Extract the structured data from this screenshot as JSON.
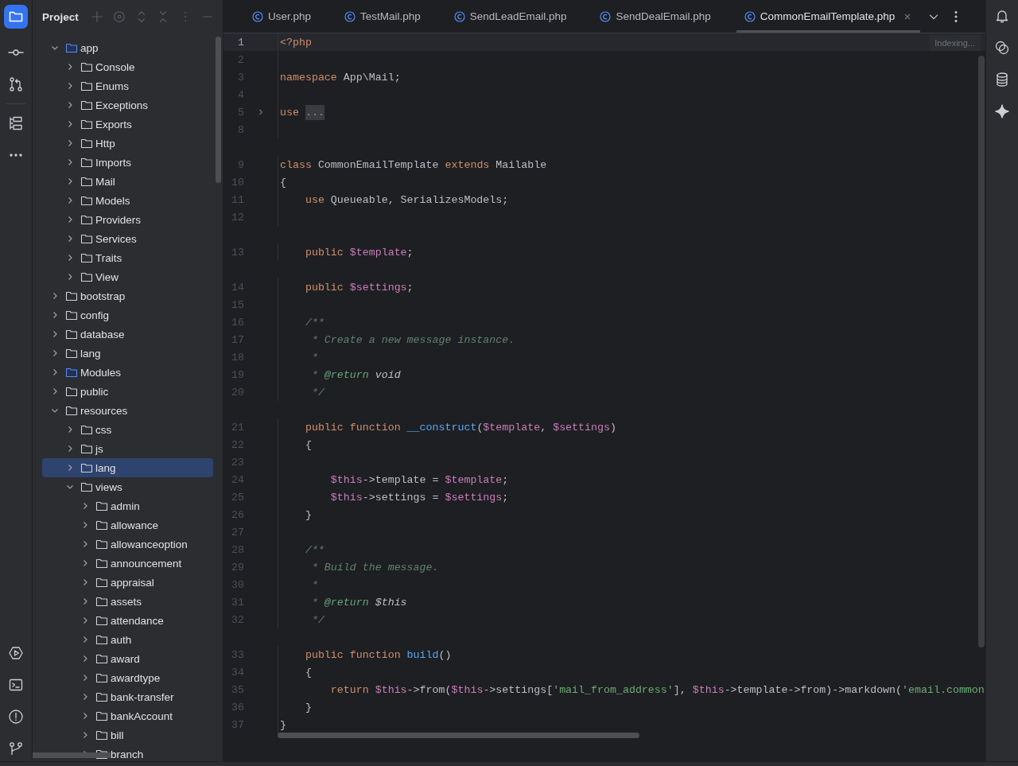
{
  "project_panel": {
    "title": "Project",
    "tree": [
      {
        "label": "app",
        "kind": "source",
        "expanded": true,
        "selected": false,
        "children": [
          {
            "label": "Console",
            "kind": "folder",
            "expanded": false,
            "selected": false
          },
          {
            "label": "Enums",
            "kind": "folder",
            "expanded": false,
            "selected": false
          },
          {
            "label": "Exceptions",
            "kind": "folder",
            "expanded": false,
            "selected": false
          },
          {
            "label": "Exports",
            "kind": "folder",
            "expanded": false,
            "selected": false
          },
          {
            "label": "Http",
            "kind": "folder",
            "expanded": false,
            "selected": false
          },
          {
            "label": "Imports",
            "kind": "folder",
            "expanded": false,
            "selected": false
          },
          {
            "label": "Mail",
            "kind": "folder",
            "expanded": false,
            "selected": false
          },
          {
            "label": "Models",
            "kind": "folder",
            "expanded": false,
            "selected": false
          },
          {
            "label": "Providers",
            "kind": "folder",
            "expanded": false,
            "selected": false
          },
          {
            "label": "Services",
            "kind": "folder",
            "expanded": false,
            "selected": false
          },
          {
            "label": "Traits",
            "kind": "folder",
            "expanded": false,
            "selected": false
          },
          {
            "label": "View",
            "kind": "folder",
            "expanded": false,
            "selected": false
          }
        ]
      },
      {
        "label": "bootstrap",
        "kind": "folder",
        "expanded": false,
        "selected": false
      },
      {
        "label": "config",
        "kind": "folder",
        "expanded": false,
        "selected": false
      },
      {
        "label": "database",
        "kind": "folder",
        "expanded": false,
        "selected": false
      },
      {
        "label": "lang",
        "kind": "folder",
        "expanded": false,
        "selected": false
      },
      {
        "label": "Modules",
        "kind": "source",
        "expanded": false,
        "selected": false
      },
      {
        "label": "public",
        "kind": "folder",
        "expanded": false,
        "selected": false
      },
      {
        "label": "resources",
        "kind": "folder",
        "expanded": true,
        "selected": false,
        "children": [
          {
            "label": "css",
            "kind": "folder",
            "expanded": false,
            "selected": false
          },
          {
            "label": "js",
            "kind": "folder",
            "expanded": false,
            "selected": false
          },
          {
            "label": "lang",
            "kind": "folder",
            "expanded": false,
            "selected": true
          },
          {
            "label": "views",
            "kind": "folder",
            "expanded": true,
            "selected": false,
            "children": [
              {
                "label": "admin",
                "kind": "folder",
                "expanded": false,
                "selected": false
              },
              {
                "label": "allowance",
                "kind": "folder",
                "expanded": false,
                "selected": false
              },
              {
                "label": "allowanceoption",
                "kind": "folder",
                "expanded": false,
                "selected": false
              },
              {
                "label": "announcement",
                "kind": "folder",
                "expanded": false,
                "selected": false
              },
              {
                "label": "appraisal",
                "kind": "folder",
                "expanded": false,
                "selected": false
              },
              {
                "label": "assets",
                "kind": "folder",
                "expanded": false,
                "selected": false
              },
              {
                "label": "attendance",
                "kind": "folder",
                "expanded": false,
                "selected": false
              },
              {
                "label": "auth",
                "kind": "folder",
                "expanded": false,
                "selected": false
              },
              {
                "label": "award",
                "kind": "folder",
                "expanded": false,
                "selected": false
              },
              {
                "label": "awardtype",
                "kind": "folder",
                "expanded": false,
                "selected": false
              },
              {
                "label": "bank-transfer",
                "kind": "folder",
                "expanded": false,
                "selected": false
              },
              {
                "label": "bankAccount",
                "kind": "folder",
                "expanded": false,
                "selected": false
              },
              {
                "label": "bill",
                "kind": "folder",
                "expanded": false,
                "selected": false
              },
              {
                "label": "branch",
                "kind": "folder",
                "expanded": false,
                "selected": false
              }
            ]
          }
        ]
      }
    ]
  },
  "tabs": [
    {
      "label": "User.php",
      "selected": false
    },
    {
      "label": "TestMail.php",
      "selected": false
    },
    {
      "label": "SendLeadEmail.php",
      "selected": false
    },
    {
      "label": "SendDealEmail.php",
      "selected": false
    },
    {
      "label": "CommonEmailTemplate.php",
      "selected": true
    }
  ],
  "editor": {
    "status": "Indexing...",
    "code": [
      [
        {
          "n": "1",
          "current": true,
          "tokens": [
            {
              "kind": "kw",
              "text": "<?php"
            }
          ]
        },
        {
          "n": "2",
          "current": false
        },
        {
          "n": "3",
          "current": false,
          "tokens": [
            {
              "kind": "kw",
              "text": "namespace"
            },
            {
              "kind": "pl",
              "text": " App\\Mail;"
            }
          ]
        },
        {
          "n": "4",
          "current": false
        },
        {
          "n": "5",
          "current": false,
          "tokens": [
            {
              "kind": "kw",
              "text": "use "
            },
            {
              "kind": "fold",
              "text": "..."
            }
          ]
        },
        {
          "n": "8",
          "current": false
        }
      ],
      [
        {
          "n": "9",
          "current": false,
          "tokens": [
            {
              "kind": "kw",
              "text": "class"
            },
            {
              "kind": "pl",
              "text": " CommonEmailTemplate "
            },
            {
              "kind": "kw",
              "text": "extends"
            },
            {
              "kind": "pl",
              "text": " Mailable"
            }
          ]
        },
        {
          "n": "10",
          "current": false,
          "tokens": [
            {
              "kind": "pl",
              "text": "{"
            }
          ]
        },
        {
          "n": "11",
          "current": false,
          "tokens": [
            {
              "kind": "kw",
              "text": "    use"
            },
            {
              "kind": "pl",
              "text": " Queueable, SerializesModels;"
            }
          ]
        },
        {
          "n": "12",
          "current": false
        }
      ],
      [
        {
          "n": "13",
          "current": false,
          "tokens": [
            {
              "kind": "kw",
              "text": "    public"
            },
            {
              "kind": "var",
              "text": " $template"
            },
            {
              "kind": "pl",
              "text": ";"
            }
          ]
        }
      ],
      [
        {
          "n": "14",
          "current": false,
          "tokens": [
            {
              "kind": "kw",
              "text": "    public"
            },
            {
              "kind": "var",
              "text": " $settings"
            },
            {
              "kind": "pl",
              "text": ";"
            }
          ]
        },
        {
          "n": "15",
          "current": false
        },
        {
          "n": "16",
          "current": false,
          "tokens": [
            {
              "kind": "cm",
              "text": "    /**"
            }
          ]
        },
        {
          "n": "17",
          "current": false,
          "tokens": [
            {
              "kind": "cm",
              "text": "     * Create a new message instance."
            }
          ]
        },
        {
          "n": "18",
          "current": false,
          "tokens": [
            {
              "kind": "cm",
              "text": "     *"
            }
          ]
        },
        {
          "n": "19",
          "current": false,
          "tokens": [
            {
              "kind": "cm",
              "text": "     * "
            },
            {
              "kind": "tag",
              "text": "@return"
            },
            {
              "kind": "doc",
              "text": " void"
            }
          ]
        },
        {
          "n": "20",
          "current": false,
          "tokens": [
            {
              "kind": "cm",
              "text": "     */"
            }
          ]
        }
      ],
      [
        {
          "n": "21",
          "current": false,
          "tokens": [
            {
              "kind": "kw",
              "text": "    public function"
            },
            {
              "kind": "fn",
              "text": " __construct"
            },
            {
              "kind": "pl",
              "text": "("
            },
            {
              "kind": "var",
              "text": "$template"
            },
            {
              "kind": "pl",
              "text": ", "
            },
            {
              "kind": "var",
              "text": "$settings"
            },
            {
              "kind": "pl",
              "text": ")"
            }
          ]
        },
        {
          "n": "22",
          "current": false,
          "tokens": [
            {
              "kind": "pl",
              "text": "    {"
            }
          ]
        },
        {
          "n": "23",
          "current": false
        },
        {
          "n": "24",
          "current": false,
          "tokens": [
            {
              "kind": "var",
              "text": "        $this"
            },
            {
              "kind": "pl",
              "text": "->template = "
            },
            {
              "kind": "var",
              "text": "$template"
            },
            {
              "kind": "pl",
              "text": ";"
            }
          ]
        },
        {
          "n": "25",
          "current": false,
          "tokens": [
            {
              "kind": "var",
              "text": "        $this"
            },
            {
              "kind": "pl",
              "text": "->settings = "
            },
            {
              "kind": "var",
              "text": "$settings"
            },
            {
              "kind": "pl",
              "text": ";"
            }
          ]
        },
        {
          "n": "26",
          "current": false,
          "tokens": [
            {
              "kind": "pl",
              "text": "    }"
            }
          ]
        },
        {
          "n": "27",
          "current": false
        },
        {
          "n": "28",
          "current": false,
          "tokens": [
            {
              "kind": "cm",
              "text": "    /**"
            }
          ]
        },
        {
          "n": "29",
          "current": false,
          "tokens": [
            {
              "kind": "cm",
              "text": "     * Build the message."
            }
          ]
        },
        {
          "n": "30",
          "current": false,
          "tokens": [
            {
              "kind": "cm",
              "text": "     *"
            }
          ]
        },
        {
          "n": "31",
          "current": false,
          "tokens": [
            {
              "kind": "cm",
              "text": "     * "
            },
            {
              "kind": "tag",
              "text": "@return"
            },
            {
              "kind": "doc",
              "text": " $this"
            }
          ]
        },
        {
          "n": "32",
          "current": false,
          "tokens": [
            {
              "kind": "cm",
              "text": "     */"
            }
          ]
        }
      ],
      [
        {
          "n": "33",
          "current": false,
          "tokens": [
            {
              "kind": "kw",
              "text": "    public function"
            },
            {
              "kind": "fn",
              "text": " build"
            },
            {
              "kind": "pl",
              "text": "()"
            }
          ]
        },
        {
          "n": "34",
          "current": false,
          "tokens": [
            {
              "kind": "pl",
              "text": "    {"
            }
          ]
        },
        {
          "n": "35",
          "current": false,
          "tokens": [
            {
              "kind": "kw",
              "text": "        return"
            },
            {
              "kind": "var",
              "text": " $this"
            },
            {
              "kind": "pl",
              "text": "->from("
            },
            {
              "kind": "var",
              "text": "$this"
            },
            {
              "kind": "pl",
              "text": "->settings["
            },
            {
              "kind": "str",
              "text": "'mail_from_address'"
            },
            {
              "kind": "pl",
              "text": "], "
            },
            {
              "kind": "var",
              "text": "$this"
            },
            {
              "kind": "pl",
              "text": "->template->from)->markdown("
            },
            {
              "kind": "str",
              "text": "'email.common"
            }
          ]
        },
        {
          "n": "36",
          "current": false,
          "tokens": [
            {
              "kind": "pl",
              "text": "    }"
            }
          ]
        },
        {
          "n": "37",
          "current": false,
          "tokens": [
            {
              "kind": "pl",
              "text": "}"
            }
          ]
        }
      ]
    ]
  }
}
